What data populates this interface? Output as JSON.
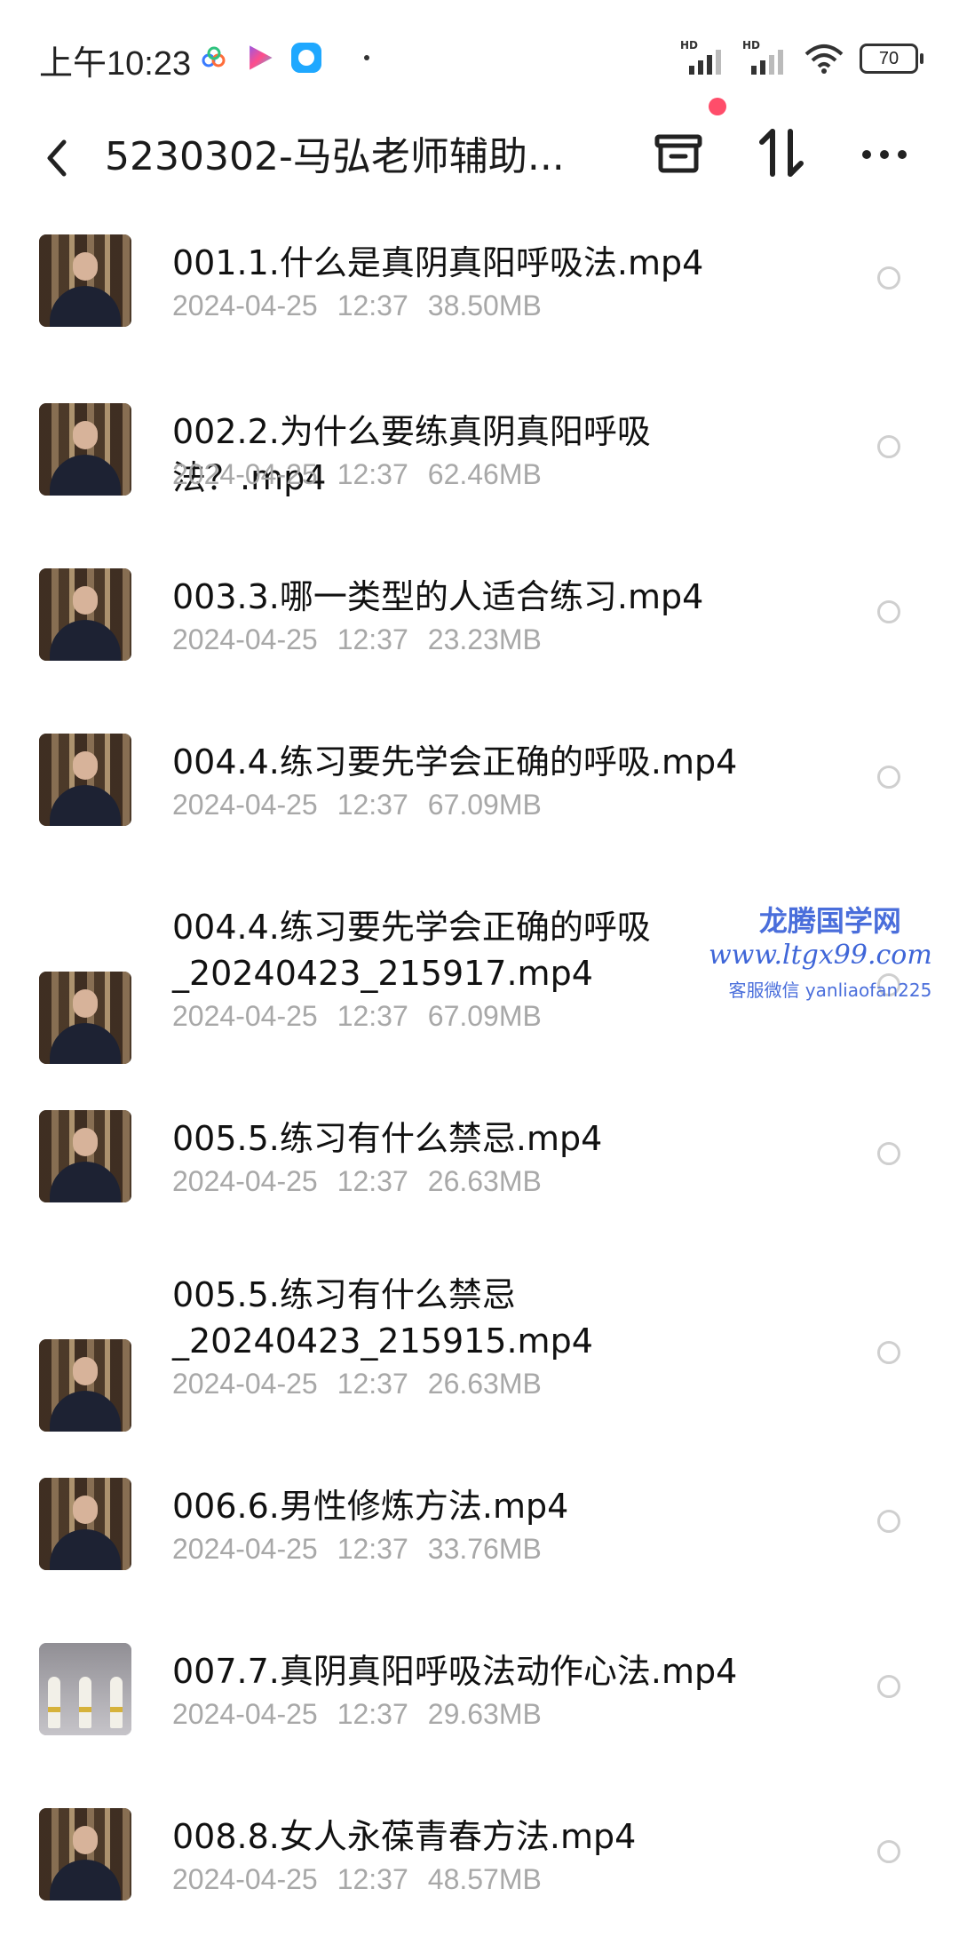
{
  "status_bar": {
    "time": "上午10:23",
    "battery": "70",
    "signal1_label": "HD",
    "signal2_label": "HD"
  },
  "toolbar": {
    "title": "5230302-马弘老师辅助...",
    "icons": [
      "back-icon",
      "archive-box-icon",
      "sort-icon",
      "more-icon"
    ]
  },
  "files": [
    {
      "name": "001.1.什么是真阴真阳呼吸法.mp4",
      "date": "2024-04-25",
      "time": "12:37",
      "size": "38.50MB"
    },
    {
      "name": "002.2.为什么要练真阴真阳呼吸法？.mp4",
      "date": "2024-04-25",
      "time": "12:37",
      "size": "62.46MB"
    },
    {
      "name": "003.3.哪一类型的人适合练习.mp4",
      "date": "2024-04-25",
      "time": "12:37",
      "size": "23.23MB"
    },
    {
      "name": "004.4.练习要先学会正确的呼吸.mp4",
      "date": "2024-04-25",
      "time": "12:37",
      "size": "67.09MB"
    },
    {
      "name": "004.4.练习要先学会正确的呼吸\n_20240423_215917.mp4",
      "date": "2024-04-25",
      "time": "12:37",
      "size": "67.09MB"
    },
    {
      "name": "005.5.练习有什么禁忌.mp4",
      "date": "2024-04-25",
      "time": "12:37",
      "size": "26.63MB"
    },
    {
      "name": "005.5.练习有什么禁忌\n_20240423_215915.mp4",
      "date": "2024-04-25",
      "time": "12:37",
      "size": "26.63MB"
    },
    {
      "name": "006.6.男性修炼方法.mp4",
      "date": "2024-04-25",
      "time": "12:37",
      "size": "33.76MB"
    },
    {
      "name": "007.7.真阴真阳呼吸法动作心法.mp4",
      "date": "2024-04-25",
      "time": "12:37",
      "size": "29.63MB"
    },
    {
      "name": "008.8.女人永葆青春方法.mp4",
      "date": "2024-04-25",
      "time": "12:37",
      "size": "48.57MB"
    }
  ],
  "watermark": {
    "line1": "龙腾国学网",
    "line2": "www.ltgx99.com",
    "line3": "客服微信 yanliaofan225"
  },
  "colors": {
    "accent_dot": "#ff4d6a",
    "meta_gray": "#a8a8a8",
    "watermark_blue": "#4a6edb"
  }
}
